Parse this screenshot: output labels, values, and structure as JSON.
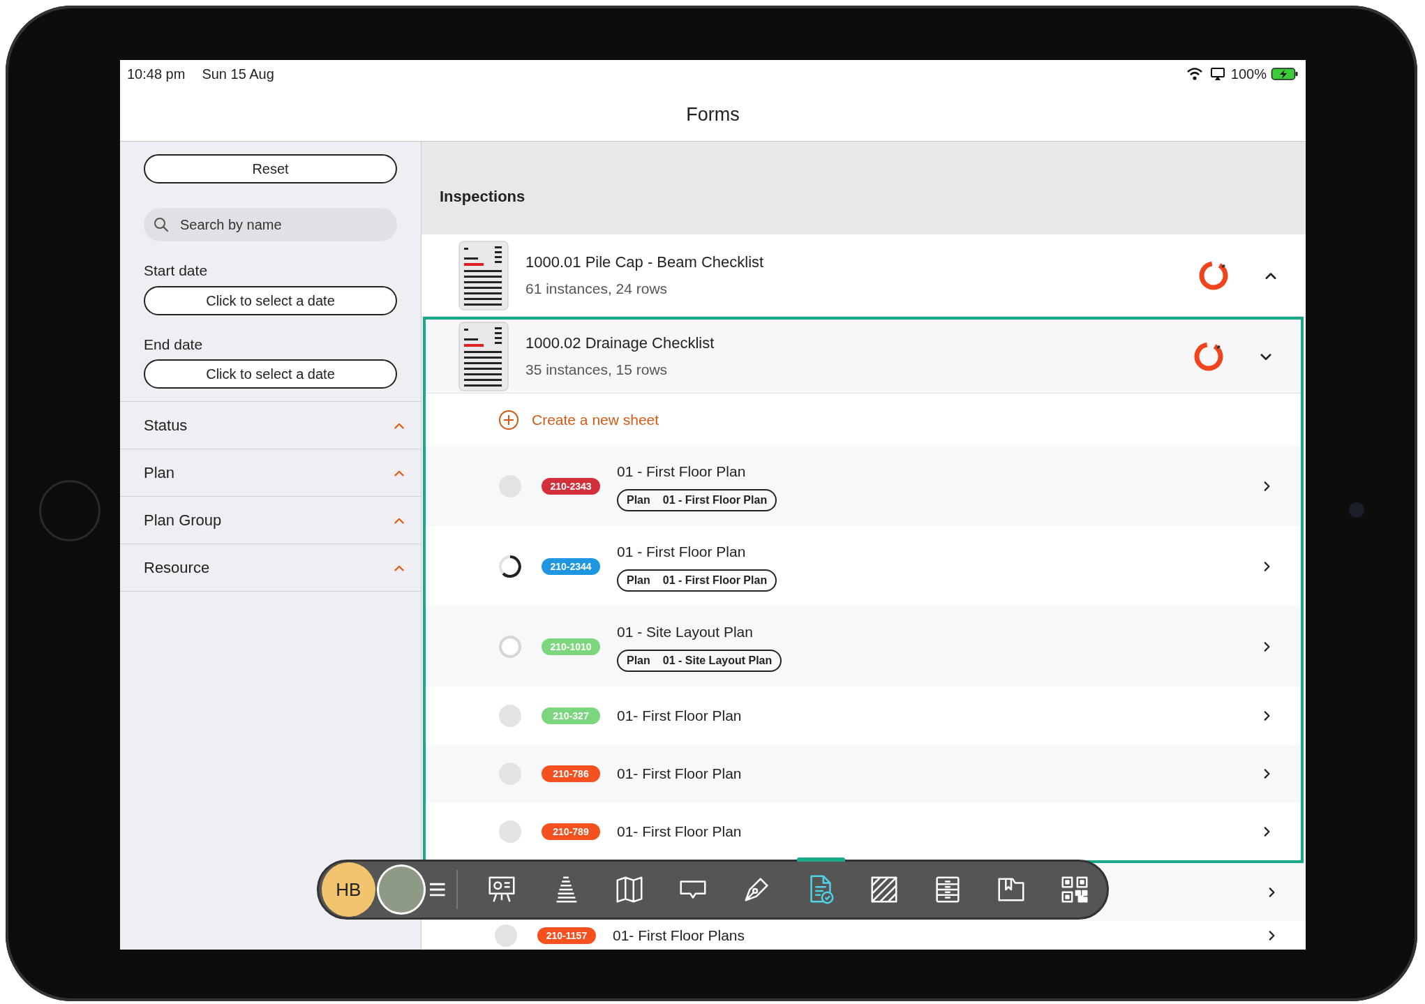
{
  "status_bar": {
    "time": "10:48 pm",
    "date": "Sun 15 Aug",
    "battery": "100%"
  },
  "nav": {
    "title": "Forms"
  },
  "sidebar": {
    "reset_button": "Reset",
    "search": {
      "placeholder": "Search by name"
    },
    "date_fields": [
      {
        "label": "Start date",
        "button": "Click to select a date"
      },
      {
        "label": "End date",
        "button": "Click to select a date"
      }
    ],
    "filters": [
      {
        "label": "Status"
      },
      {
        "label": "Plan"
      },
      {
        "label": "Plan Group"
      },
      {
        "label": "Resource"
      }
    ]
  },
  "section": {
    "title": "Inspections"
  },
  "forms": [
    {
      "title": "1000.01 Pile Cap - Beam Checklist",
      "subtitle": "61 instances, 24 rows",
      "expanded": false,
      "highlighted": false
    },
    {
      "title": "1000.02 Drainage Checklist",
      "subtitle": "35 instances, 15 rows",
      "expanded": true,
      "highlighted": true,
      "create_label": "Create a new sheet",
      "sheets": [
        {
          "kind": "tagged",
          "dot": {
            "kind": "filled"
          },
          "id": "210-2343",
          "color": "#d32f3a",
          "title": "01 - First Floor Plan",
          "tag_label": "Plan",
          "tag_value": "01 - First Floor Plan"
        },
        {
          "kind": "tagged",
          "dot": {
            "kind": "spinner"
          },
          "id": "210-2344",
          "color": "#1e96e0",
          "title": "01 - First Floor Plan",
          "tag_label": "Plan",
          "tag_value": "01 - First Floor Plan"
        },
        {
          "kind": "tagged",
          "dot": {
            "kind": "ring"
          },
          "id": "210-1010",
          "color": "#7bd67e",
          "title": "01 - Site Layout Plan",
          "tag_label": "Plan",
          "tag_value": "01 - Site Layout Plan"
        },
        {
          "kind": "plain",
          "dot": {
            "kind": "filled"
          },
          "id": "210-327",
          "color": "#7bd67e",
          "title": "01- First Floor Plan"
        },
        {
          "kind": "plain",
          "dot": {
            "kind": "filled"
          },
          "id": "210-786",
          "color": "#f4511e",
          "title": "01- First Floor Plan"
        },
        {
          "kind": "plain",
          "dot": {
            "kind": "filled"
          },
          "id": "210-789",
          "color": "#f4511e",
          "title": "01- First Floor Plan"
        },
        {
          "kind": "covered"
        },
        {
          "kind": "plain",
          "dot": {
            "kind": "filled"
          },
          "id": "210-1157",
          "color": "#f4511e",
          "title": "01- First Floor Plans"
        }
      ]
    }
  ],
  "toolbar": {
    "avatar_initials": "HB",
    "items": [
      {
        "kind": "presentation",
        "selected": false
      },
      {
        "kind": "buildings",
        "selected": false
      },
      {
        "kind": "map",
        "selected": false
      },
      {
        "kind": "comment",
        "selected": false
      },
      {
        "kind": "pen",
        "selected": false
      },
      {
        "kind": "form",
        "selected": true
      },
      {
        "kind": "hatch",
        "selected": false
      },
      {
        "kind": "cabinet",
        "selected": false
      },
      {
        "kind": "folder",
        "selected": false
      },
      {
        "kind": "qr",
        "selected": false
      }
    ]
  }
}
